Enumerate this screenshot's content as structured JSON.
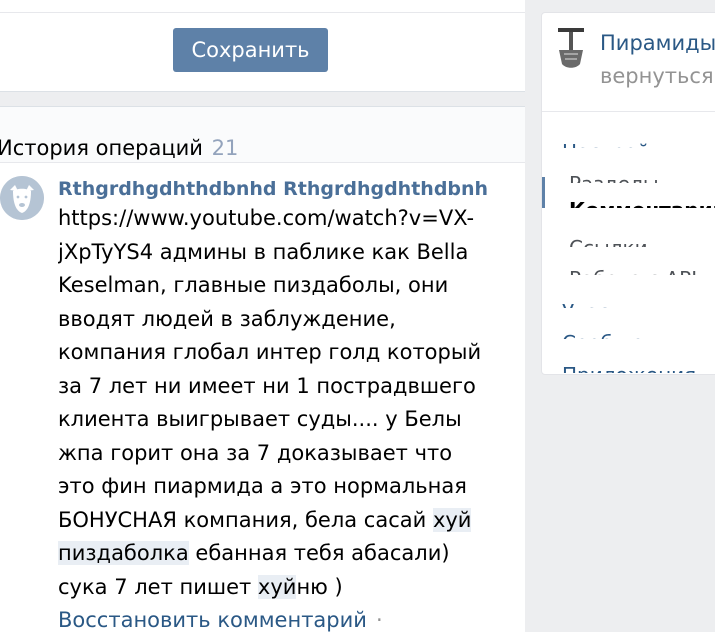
{
  "toolbar": {
    "save_label": "Сохранить"
  },
  "history": {
    "title": "История операций",
    "count": "21",
    "comment": {
      "author": "Rthgrdhgdhthdbnhd Rthgrdhgdhthdbnhd",
      "text_parts": [
        "https://www.youtube.com/watch?v=VX-jXpTyYS4 админы в паблике как Bella Keselman, главные пиздаболы, они вводят людей в заблуждение, компания глобал интер голд который за 7 лет ни имеет ни 1 пострадвшего клиента выигрывает суды.... у Белы жпа горит она за 7 доказывает что это фин пиармида а это нормальная БОНУСНАЯ компания, бела сасай ",
        "хуй",
        " ",
        "пиздаболка",
        " ебанная тебя абасали) сука 7 лет пишет ",
        "хуй",
        "ню )"
      ],
      "restore_label": "Восстановить комментарий",
      "restore_sep": "·"
    }
  },
  "sidebar": {
    "group_name": "Пирамиды",
    "back_label": "вернуться",
    "nav": {
      "settings": "Настройки",
      "sections": "Разделы",
      "comments": "Комментарии",
      "links": "Ссылки",
      "api": "Работа с API",
      "members": "Участники",
      "messages": "Сообщения",
      "apps": "Приложения"
    }
  }
}
